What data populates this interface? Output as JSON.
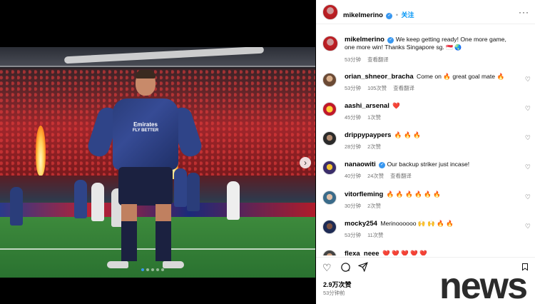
{
  "post": {
    "username": "mikelmerino",
    "follow_label": "关注",
    "more_label": "···",
    "caption_text": "We keep getting ready! One more game, one more win! Thanks Singapore sg. ",
    "caption_emoji": "🇸🇬 🌏",
    "caption_time": "53分钟",
    "caption_translate": "查看翻译"
  },
  "comments": [
    {
      "user": "orian_shneor_bracha",
      "text": "Come on 🔥 great goal mate 🔥",
      "time": "53分钟",
      "likes": "105次赞",
      "translate": "查看翻译"
    },
    {
      "user": "aashi_arsenal",
      "text": "❤️",
      "time": "45分钟",
      "likes": "1次赞",
      "translate": ""
    },
    {
      "user": "drippypaypers",
      "text": "🔥 🔥 🔥",
      "time": "28分钟",
      "likes": "2次赞",
      "translate": ""
    },
    {
      "user": "nanaowiti",
      "text": "Our backup striker just incase!",
      "time": "40分钟",
      "likes": "24次赞",
      "translate": "查看翻译"
    },
    {
      "user": "vitorfleming",
      "text": "🔥 🔥 🔥 🔥 🔥 🔥",
      "time": "30分钟",
      "likes": "2次赞",
      "translate": ""
    },
    {
      "user": "mocky254",
      "text": "Merinoooooo 🙌 🙌 🔥 🔥",
      "time": "53分钟",
      "likes": "11次赞",
      "translate": ""
    },
    {
      "user": "flexa_neee",
      "text": "❤️ ❤️ ❤️ ❤️ ❤️",
      "time": "",
      "likes": "",
      "translate": ""
    }
  ],
  "footer": {
    "likes_count": "2.9万次赞",
    "posted_time": "53分钟前"
  },
  "photo": {
    "sponsor_line1": "Emirates",
    "sponsor_line2": "FLY BETTER"
  },
  "watermark": "news",
  "colors": {
    "accent": "#0095f6",
    "verified": "#3897f0",
    "meta_gray": "#737373"
  }
}
